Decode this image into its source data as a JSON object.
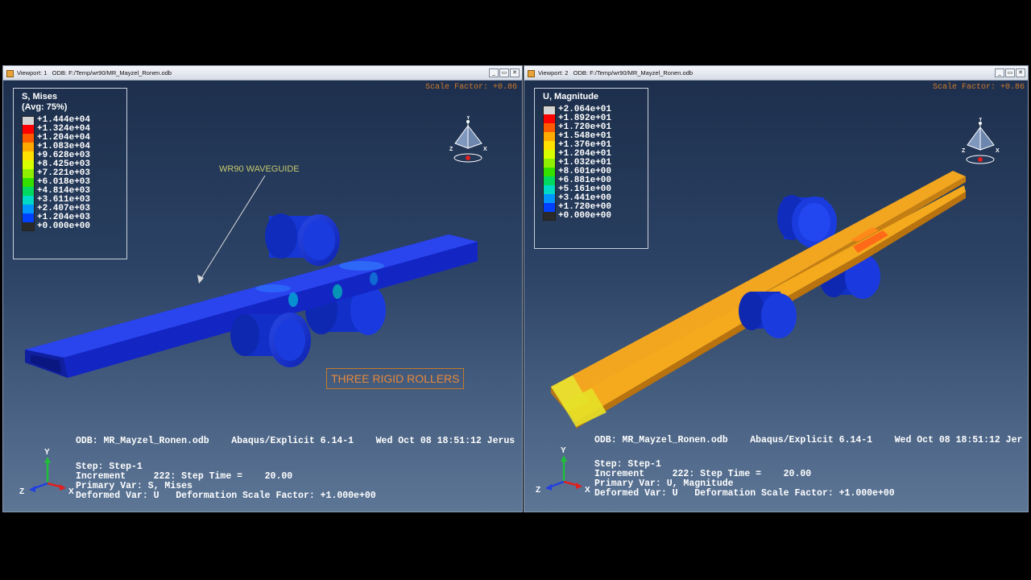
{
  "viewport1": {
    "title_num": "Viewport: 1",
    "title_odb": "ODB: F:/Temp/wr90/MR_Mayzel_Ronen.odb",
    "scale_factor": "Scale Factor: +0.86",
    "legend": {
      "title": "S, Mises",
      "subtitle": "(Avg: 75%)",
      "values": [
        "+1.444e+04",
        "+1.324e+04",
        "+1.204e+04",
        "+1.083e+04",
        "+9.628e+03",
        "+8.425e+03",
        "+7.221e+03",
        "+6.018e+03",
        "+4.814e+03",
        "+3.611e+03",
        "+2.407e+03",
        "+1.204e+03",
        "+0.000e+00"
      ],
      "colors": [
        "#d4d4d4",
        "#ff0000",
        "#ff5a00",
        "#ffaa00",
        "#ffe000",
        "#d7ff00",
        "#8ef000",
        "#33e000",
        "#00d860",
        "#00d8c8",
        "#0096ff",
        "#0040ff",
        "#2a2a2a"
      ]
    },
    "annotation_waveguide": "WR90 WAVEGUIDE",
    "annotation_rollers": "THREE RIGID ROLLERS",
    "info": {
      "odb": "ODB: MR_Mayzel_Ronen.odb    Abaqus/Explicit 6.14-1    Wed Oct 08 18:51:12 Jerus",
      "step": "Step: Step-1",
      "increment": "Increment     222: Step Time =    20.00",
      "primary": "Primary Var: S, Mises",
      "deformed": "Deformed Var: U   Deformation Scale Factor: +1.000e+00"
    }
  },
  "viewport2": {
    "title_num": "Viewport: 2",
    "title_odb": "ODB: F:/Temp/wr90/MR_Mayzel_Ronen.odb",
    "scale_factor": "Scale Factor: +0.86",
    "legend": {
      "title": "U, Magnitude",
      "values": [
        "+2.064e+01",
        "+1.892e+01",
        "+1.720e+01",
        "+1.548e+01",
        "+1.376e+01",
        "+1.204e+01",
        "+1.032e+01",
        "+8.601e+00",
        "+6.881e+00",
        "+5.161e+00",
        "+3.441e+00",
        "+1.720e+00",
        "+0.000e+00"
      ],
      "colors": [
        "#d4d4d4",
        "#ff0000",
        "#ff5a00",
        "#ffaa00",
        "#ffe000",
        "#d7ff00",
        "#8ef000",
        "#33e000",
        "#00d860",
        "#00d8c8",
        "#0096ff",
        "#0040ff",
        "#2a2a2a"
      ]
    },
    "info": {
      "odb": "ODB: MR_Mayzel_Ronen.odb    Abaqus/Explicit 6.14-1    Wed Oct 08 18:51:12 Jer",
      "step": "Step: Step-1",
      "increment": "Increment     222: Step Time =    20.00",
      "primary": "Primary Var: U, Magnitude",
      "deformed": "Deformed Var: U   Deformation Scale Factor: +1.000e+00"
    }
  },
  "axes": {
    "x": "X",
    "y": "Y",
    "z": "Z"
  },
  "window_buttons": {
    "minimize": "_",
    "restore": "▭",
    "close": "✕"
  }
}
